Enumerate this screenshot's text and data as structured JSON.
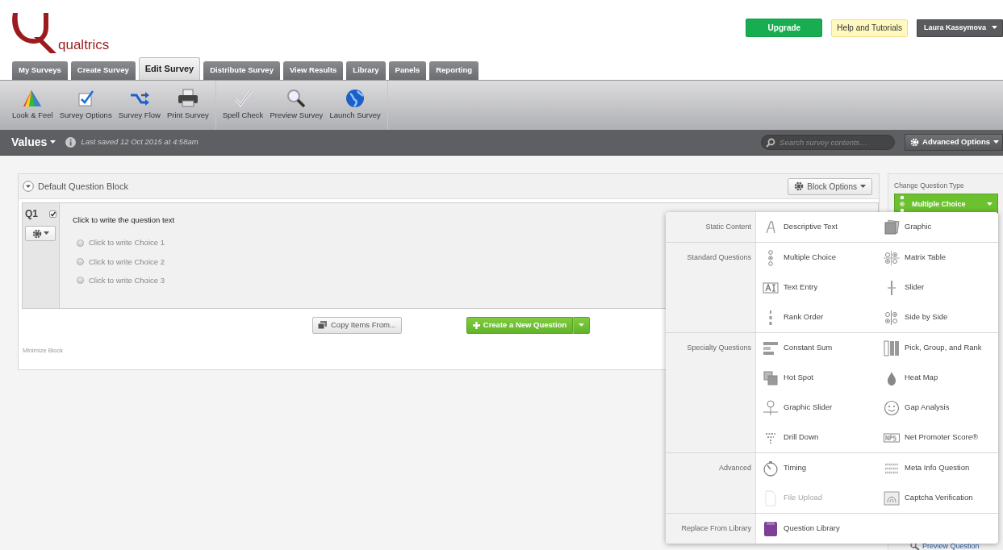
{
  "logo": {
    "text": "qualtrics"
  },
  "header_buttons": {
    "upgrade": "Upgrade",
    "help": "Help and Tutorials",
    "user": "Laura Kassymova"
  },
  "tabs": [
    {
      "label": "My Surveys",
      "selected": false
    },
    {
      "label": "Create Survey",
      "selected": false
    },
    {
      "label": "Edit Survey",
      "selected": true
    },
    {
      "label": "Distribute Survey",
      "selected": false
    },
    {
      "label": "View Results",
      "selected": false
    },
    {
      "label": "Library",
      "selected": false
    },
    {
      "label": "Panels",
      "selected": false
    },
    {
      "label": "Reporting",
      "selected": false
    }
  ],
  "toolbar": {
    "groups": [
      [
        "Look & Feel",
        "Survey Options",
        "Survey Flow",
        "Print Survey"
      ],
      [
        "Spell Check",
        "Preview Survey",
        "Launch Survey"
      ]
    ]
  },
  "survey_bar": {
    "title": "Values",
    "last_saved": "Last saved 12 Oct 2015 at 4:58am",
    "search_placeholder": "Search survey contents…",
    "advanced_options": "Advanced Options"
  },
  "block": {
    "title": "Default Question Block",
    "options": "Block Options",
    "question": {
      "number": "Q1",
      "checked": true,
      "text": "Click to write the question text",
      "choices": [
        {
          "label": "Click to write Choice 1",
          "selected": false
        },
        {
          "label": "Click to write Choice 2",
          "selected": false
        },
        {
          "label": "Click to write Choice 3",
          "selected": false
        }
      ]
    },
    "copy_button": "Copy Items From...",
    "create_button": "Create a New Question",
    "minimize": "Minimize Block"
  },
  "side_panel": {
    "heading": "Change Question Type",
    "type_button": "Multiple Choice",
    "preview_link": "Preview Question"
  },
  "type_menu": {
    "sections": [
      {
        "label": "Static Content",
        "items": [
          {
            "label": "Descriptive Text",
            "disabled": false
          },
          {
            "label": "Graphic",
            "disabled": false
          }
        ]
      },
      {
        "label": "Standard Questions",
        "items": [
          {
            "label": "Multiple Choice",
            "disabled": false
          },
          {
            "label": "Matrix Table",
            "disabled": false
          },
          {
            "label": "Text Entry",
            "disabled": false
          },
          {
            "label": "Slider",
            "disabled": false
          },
          {
            "label": "Rank Order",
            "disabled": false
          },
          {
            "label": "Side by Side",
            "disabled": false
          }
        ]
      },
      {
        "label": "Specialty Questions",
        "items": [
          {
            "label": "Constant Sum",
            "disabled": false
          },
          {
            "label": "Pick, Group, and Rank",
            "disabled": false
          },
          {
            "label": "Hot Spot",
            "disabled": false
          },
          {
            "label": "Heat Map",
            "disabled": false
          },
          {
            "label": "Graphic Slider",
            "disabled": false
          },
          {
            "label": "Gap Analysis",
            "disabled": false
          },
          {
            "label": "Drill Down",
            "disabled": false
          },
          {
            "label": "Net Promoter Score®",
            "disabled": false
          }
        ]
      },
      {
        "label": "Advanced",
        "items": [
          {
            "label": "Timing",
            "disabled": false
          },
          {
            "label": "Meta Info Question",
            "disabled": false
          },
          {
            "label": "File Upload",
            "disabled": true
          },
          {
            "label": "Captcha Verification",
            "disabled": false
          }
        ]
      },
      {
        "label": "Replace From Library",
        "items": [
          {
            "label": "Question Library",
            "disabled": false
          }
        ]
      }
    ]
  }
}
